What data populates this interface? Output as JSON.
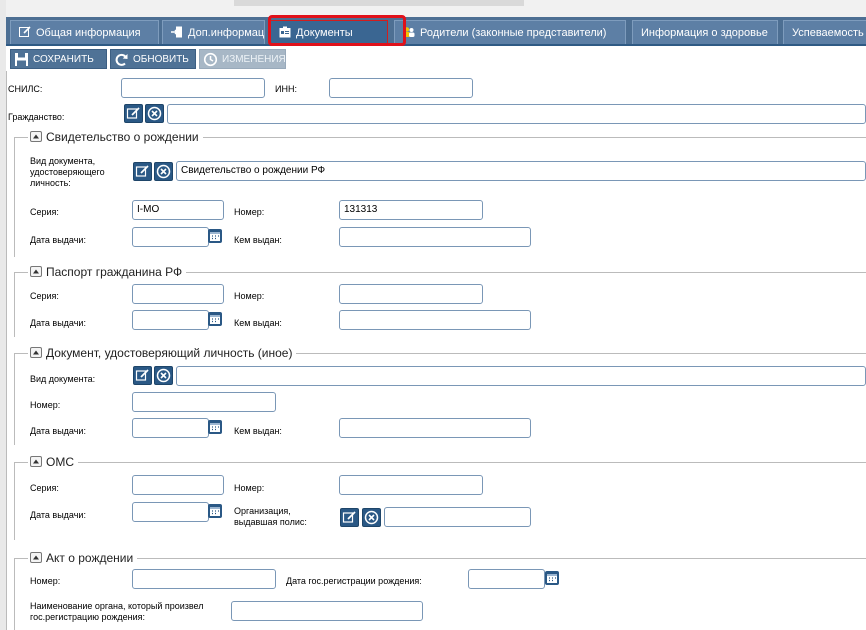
{
  "tabs": [
    {
      "label": "Общая информация",
      "icon": "edit-icon"
    },
    {
      "label": "Доп.информация",
      "icon": "import-icon"
    },
    {
      "label": "Документы",
      "icon": "documents-icon",
      "active": true
    },
    {
      "label": "Родители (законные представители)",
      "icon": "people-icon"
    },
    {
      "label": "Информация о здоровье",
      "icon": null
    },
    {
      "label": "Успеваемость",
      "icon": null
    }
  ],
  "toolbar": {
    "save_label": "СОХРАНИТЬ",
    "refresh_label": "ОБНОВИТЬ",
    "changes_label": "ИЗМЕНЕНИЯ"
  },
  "top": {
    "snils_label": "СНИЛС:",
    "snils_value": "",
    "inn_label": "ИНН:",
    "inn_value": "",
    "citizenship_label": "Гражданство:",
    "citizenship_value": ""
  },
  "birth_cert": {
    "legend": "Свидетельство о рождении",
    "doc_type_label": "Вид документа, удостоверяющего личность:",
    "doc_type_value": "Свидетельство о рождении РФ",
    "series_label": "Серия:",
    "series_value": "I-МО",
    "number_label": "Номер:",
    "number_value": "131313",
    "issue_date_label": "Дата выдачи:",
    "issue_date_value": "",
    "issued_by_label": "Кем выдан:",
    "issued_by_value": ""
  },
  "passport": {
    "legend": "Паспорт гражданина РФ",
    "series_label": "Серия:",
    "number_label": "Номер:",
    "issue_date_label": "Дата выдачи:",
    "issued_by_label": "Кем выдан:"
  },
  "other_id": {
    "legend": "Документ, удостоверяющий личность (иное)",
    "doc_type_label": "Вид документа:",
    "number_label": "Номер:",
    "issue_date_label": "Дата выдачи:",
    "issued_by_label": "Кем выдан:"
  },
  "oms": {
    "legend": "ОМС",
    "series_label": "Серия:",
    "number_label": "Номер:",
    "issue_date_label": "Дата выдачи:",
    "org_label": "Организация, выдавшая полис:"
  },
  "birth_act": {
    "legend": "Акт о рождении",
    "number_label": "Номер:",
    "reg_date_label": "Дата гос.регистрации рождения:",
    "authority_label": "Наименование органа, который произвел гос.регистрацию рождения:"
  },
  "colors": {
    "tab_bar": "#4d6f93",
    "active_highlight": "#e0111a",
    "button": "#4f7296",
    "input_border": "#7a97b6"
  }
}
